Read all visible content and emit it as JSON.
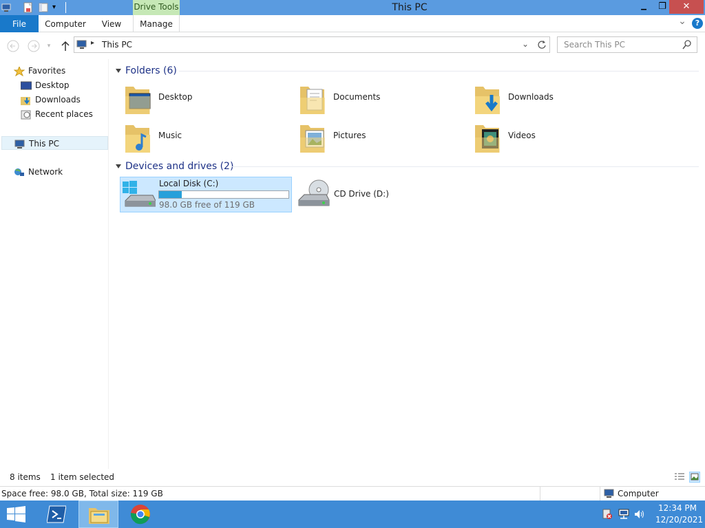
{
  "window": {
    "title": "This PC",
    "contextual_tab": "Drive Tools",
    "min_label": "▁",
    "restore_label": "❐",
    "close_label": "✕"
  },
  "ribbon": {
    "tabs": [
      {
        "label": "File"
      },
      {
        "label": "Computer"
      },
      {
        "label": "View"
      },
      {
        "label": "Manage"
      }
    ],
    "expand_label": "⌄",
    "help_label": "?"
  },
  "address": {
    "breadcrumb": "This PC",
    "separator": "▸"
  },
  "search": {
    "placeholder": "Search This PC"
  },
  "navpane": {
    "favorites": "Favorites",
    "favorite_items": [
      {
        "label": "Desktop"
      },
      {
        "label": "Downloads"
      },
      {
        "label": "Recent places"
      }
    ],
    "this_pc": "This PC",
    "network": "Network"
  },
  "content": {
    "folders_header": "Folders (6)",
    "folders": [
      {
        "label": "Desktop",
        "icon": "desktop-folder-icon"
      },
      {
        "label": "Documents",
        "icon": "documents-folder-icon"
      },
      {
        "label": "Downloads",
        "icon": "downloads-folder-icon"
      },
      {
        "label": "Music",
        "icon": "music-folder-icon"
      },
      {
        "label": "Pictures",
        "icon": "pictures-folder-icon"
      },
      {
        "label": "Videos",
        "icon": "videos-folder-icon"
      }
    ],
    "devices_header": "Devices and drives (2)",
    "drives": [
      {
        "label": "Local Disk (C:)",
        "free_text": "98.0 GB free of 119 GB",
        "used_fraction": 0.176,
        "selected": true
      },
      {
        "label": "CD Drive (D:)"
      }
    ]
  },
  "status": {
    "item_count": "8 items",
    "selection": "1 item selected"
  },
  "details": {
    "space": "Space free: 98.0 GB, Total size: 119 GB",
    "location": "Computer"
  },
  "taskbar": {
    "time": "12:34 PM",
    "date": "12/20/2021"
  },
  "colors": {
    "titlebar": "#5a9be0",
    "accent": "#1979ca",
    "taskbar": "#3f8bd6",
    "drive_bar": "#26a0da",
    "selection": "#cce8ff",
    "close_button": "#c75050"
  }
}
